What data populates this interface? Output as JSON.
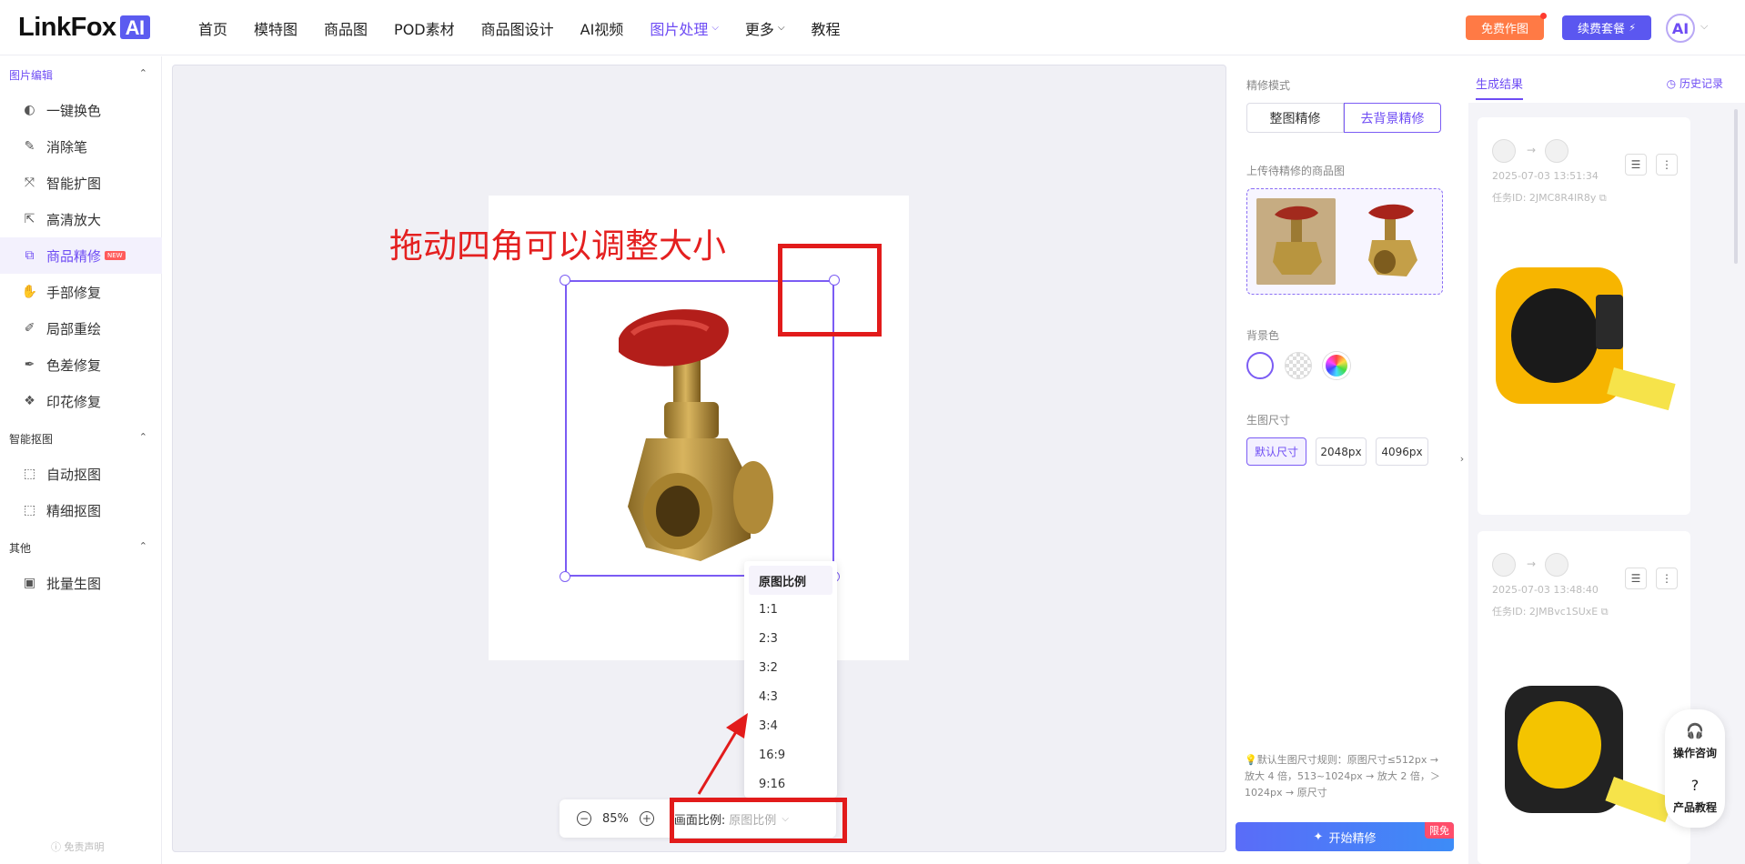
{
  "brand": {
    "name": "LinkFox",
    "badge": "AI"
  },
  "nav": [
    {
      "label": "首页"
    },
    {
      "label": "模特图"
    },
    {
      "label": "商品图"
    },
    {
      "label": "POD素材"
    },
    {
      "label": "商品图设计"
    },
    {
      "label": "AI视频"
    },
    {
      "label": "图片处理",
      "chevron": "⌵"
    },
    {
      "label": "更多",
      "chevron": "⌵"
    },
    {
      "label": "教程"
    }
  ],
  "header": {
    "free_btn": "免费作图",
    "renew_btn": "续费套餐",
    "avatar": "AI"
  },
  "sidebar": {
    "sec1": "图片编辑",
    "items1": [
      "一键换色",
      "消除笔",
      "智能扩图",
      "高清放大",
      "商品精修",
      "手部修复",
      "局部重绘",
      "色差修复",
      "印花修复"
    ],
    "new_badge": "NEW",
    "sec2": "智能抠图",
    "items2": [
      "自动抠图",
      "精细抠图"
    ],
    "sec3": "其他",
    "items3": [
      "批量生图"
    ],
    "disclaimer": "免责声明"
  },
  "canvas": {
    "hint": "拖动四角可以调整大小",
    "zoom": "85%",
    "ratio_label": "画面比例:",
    "ratio_value": "原图比例",
    "ratio_options": [
      "原图比例",
      "1:1",
      "2:3",
      "3:2",
      "4:3",
      "3:4",
      "16:9",
      "9:16"
    ]
  },
  "settings": {
    "mode_label": "精修模式",
    "mode_tabs": [
      "整图精修",
      "去背景精修"
    ],
    "upload_label": "上传待精修的商品图",
    "bg_label": "背景色",
    "size_label": "生图尺寸",
    "sizes": [
      "默认尺寸",
      "2048px",
      "4096px"
    ],
    "rule": "默认生图尺寸规则：原图尺寸≤512px → 放大 4 倍，513~1024px → 放大 2 倍，＞1024px → 原尺寸",
    "start": "开始精修",
    "limit": "限免",
    "colors": {
      "accent": "#6e4cf4",
      "start_from": "#5a6cf8",
      "start_to": "#3d8cf7",
      "hint": "#e42020"
    }
  },
  "results": {
    "tab": "生成结果",
    "history": "历史记录",
    "cards": [
      {
        "time": "2025-07-03 13:51:34",
        "id": "任务ID: 2JMC8R4IR8y"
      },
      {
        "time": "2025-07-03 13:48:40",
        "id": "任务ID: 2JMBvc1SUxE"
      }
    ]
  },
  "float_tools": {
    "consult": "操作咨询",
    "tutorial": "产品教程"
  }
}
